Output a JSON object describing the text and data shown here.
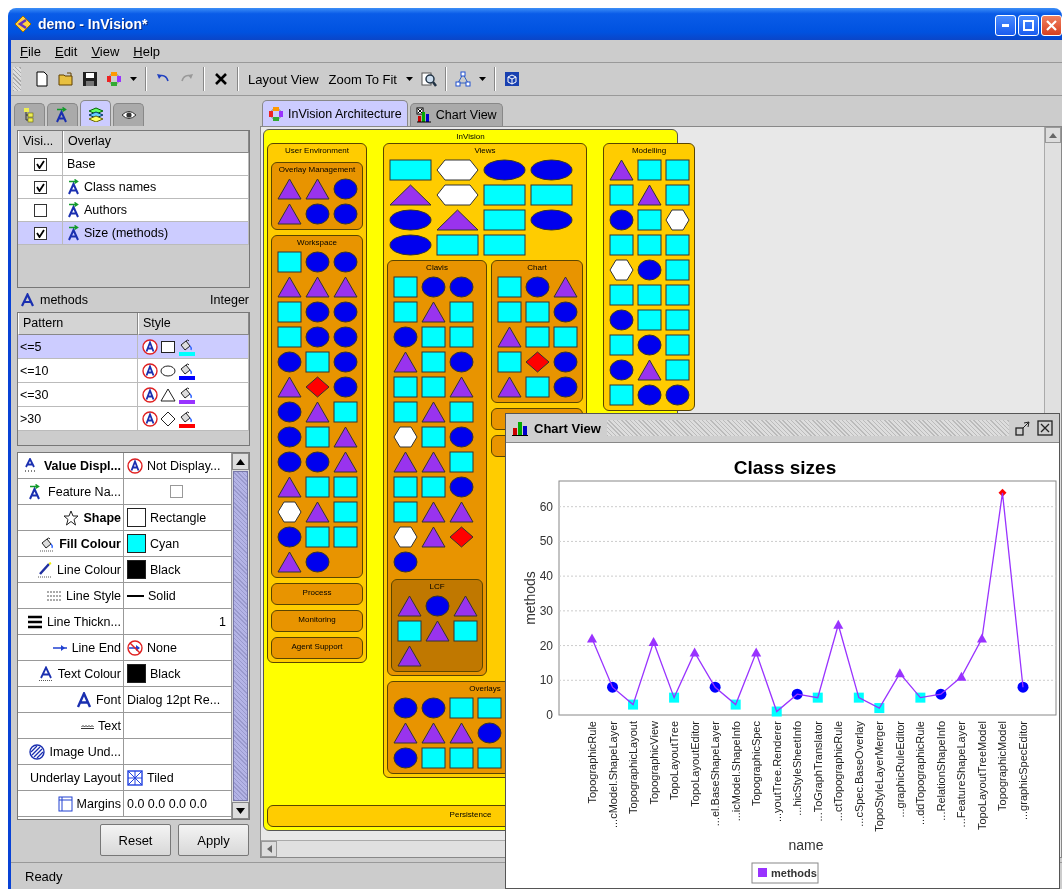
{
  "window": {
    "title": "demo - InVision*"
  },
  "menu": [
    "File",
    "Edit",
    "View",
    "Help"
  ],
  "toolbar": {
    "undo": {
      "disabled": false
    },
    "redo": {
      "disabled": true
    },
    "text_buttons": [
      "Layout View",
      "Zoom To Fit"
    ]
  },
  "panel_tabs": [
    {
      "selected": false
    },
    {
      "selected": false
    },
    {
      "selected": true
    },
    {
      "selected": false
    }
  ],
  "overlays": {
    "columns": [
      "Visi...",
      "Overlay"
    ],
    "rows": [
      {
        "name": "Base",
        "kind": "base",
        "visible": true,
        "selected": false
      },
      {
        "name": "Class names",
        "kind": "feature",
        "visible": true,
        "selected": false
      },
      {
        "name": "Authors",
        "kind": "feature",
        "visible": false,
        "selected": false
      },
      {
        "name": "Size (methods)",
        "kind": "feature",
        "visible": true,
        "selected": true
      }
    ]
  },
  "attribute": {
    "name": "methods",
    "type": "Integer"
  },
  "rules": {
    "columns": [
      "Pattern",
      "Style"
    ],
    "rows": [
      {
        "pattern": "<=5",
        "kind": "rectangle",
        "color": "#00ffff",
        "selected": true
      },
      {
        "pattern": "<=10",
        "kind": "ellipse",
        "color": "#0000ff",
        "selected": false
      },
      {
        "pattern": "<=30",
        "kind": "triangle",
        "color": "#9933ff",
        "selected": false
      },
      {
        "pattern": ">30",
        "kind": "diamond",
        "color": "#ff0000",
        "selected": false
      }
    ]
  },
  "properties": [
    {
      "label": "Value Displ...",
      "bold": true,
      "kind": "text",
      "value": "Not Display..."
    },
    {
      "label": "Feature Na...",
      "bold": false,
      "kind": "checkbox",
      "checked": false
    },
    {
      "label": "Shape",
      "bold": true,
      "kind": "swatch",
      "color": "#ffffff",
      "value": "Rectangle"
    },
    {
      "label": "Fill Colour",
      "bold": true,
      "kind": "swatch",
      "color": "#00ffff",
      "value": "Cyan"
    },
    {
      "label": "Line Colour",
      "bold": false,
      "kind": "swatch",
      "color": "#000000",
      "value": "Black"
    },
    {
      "label": "Line Style",
      "bold": false,
      "kind": "line",
      "value": "Solid"
    },
    {
      "label": "Line Thickn...",
      "bold": false,
      "kind": "number",
      "value": "1"
    },
    {
      "label": "Line End",
      "bold": false,
      "kind": "text",
      "value": "None"
    },
    {
      "label": "Text Colour",
      "bold": false,
      "kind": "swatch",
      "color": "#000000",
      "value": "Black"
    },
    {
      "label": "Font",
      "bold": false,
      "kind": "text",
      "value": "Dialog 12pt Re..."
    },
    {
      "label": "Text",
      "bold": false,
      "kind": "empty"
    },
    {
      "label": "Image Und...",
      "bold": false,
      "kind": "empty"
    },
    {
      "label": "Underlay Layout",
      "bold": false,
      "kind": "text",
      "value": "Tiled"
    },
    {
      "label": "Margins",
      "bold": false,
      "kind": "text",
      "value": "0.0 0.0 0.0 0.0"
    }
  ],
  "buttons": [
    "Reset",
    "Apply"
  ],
  "status": "Ready",
  "doc_tabs": [
    {
      "label": "InVision Architecture",
      "selected": true
    },
    {
      "label": "Chart View",
      "selected": false
    }
  ],
  "diagram": {
    "label": "InVision",
    "lanes": [
      [
        {
          "label": "User Environment",
          "groups": [
            {
              "label": "Overlay Management",
              "rows": [
                [
                  {
                    "kind": "triangle"
                  },
                  {
                    "kind": "triangle"
                  },
                  {
                    "kind": "circle"
                  }
                ],
                [
                  {
                    "kind": "triangle"
                  },
                  {
                    "kind": "circle"
                  },
                  {
                    "kind": "circle"
                  }
                ]
              ]
            },
            {
              "label": "Workspace",
              "rows": [
                [
                  {
                    "kind": "square"
                  },
                  {
                    "kind": "circle"
                  },
                  {
                    "kind": "circle"
                  }
                ],
                [
                  {
                    "kind": "triangle"
                  },
                  {
                    "kind": "triangle"
                  },
                  {
                    "kind": "triangle"
                  }
                ],
                [
                  {
                    "kind": "square"
                  },
                  {
                    "kind": "circle"
                  },
                  {
                    "kind": "circle"
                  }
                ],
                [
                  {
                    "kind": "square"
                  },
                  {
                    "kind": "circle"
                  },
                  {
                    "kind": "circle"
                  }
                ],
                [
                  {
                    "kind": "circle"
                  },
                  {
                    "kind": "square"
                  },
                  {
                    "kind": "circle"
                  }
                ],
                [
                  {
                    "kind": "triangle"
                  },
                  {
                    "kind": "diamond"
                  },
                  {
                    "kind": "circle"
                  }
                ],
                [
                  {
                    "kind": "circle"
                  },
                  {
                    "kind": "triangle"
                  },
                  {
                    "kind": "square"
                  }
                ],
                [
                  {
                    "kind": "circle"
                  },
                  {
                    "kind": "square"
                  },
                  {
                    "kind": "triangle"
                  }
                ],
                [
                  {
                    "kind": "circle"
                  },
                  {
                    "kind": "circle"
                  },
                  {
                    "kind": "triangle"
                  }
                ],
                [
                  {
                    "kind": "triangle"
                  },
                  {
                    "kind": "square"
                  },
                  {
                    "kind": "square"
                  }
                ],
                [
                  {
                    "kind": "hexagon"
                  },
                  {
                    "kind": "triangle"
                  },
                  {
                    "kind": "square"
                  }
                ],
                [
                  {
                    "kind": "circle"
                  },
                  {
                    "kind": "square"
                  },
                  {
                    "kind": "square"
                  }
                ],
                [
                  {
                    "kind": "triangle"
                  },
                  {
                    "kind": "circle"
                  }
                ]
              ]
            },
            {
              "label": "Process"
            },
            {
              "label": "Monitoring"
            },
            {
              "label": "Agent Support"
            }
          ]
        }
      ],
      [
        {
          "label": "Views",
          "rows": [
            [
              {
                "kind": "wide-rect"
              },
              {
                "kind": "wide-hexagon"
              },
              {
                "kind": "ellipse"
              },
              {
                "kind": "ellipse"
              }
            ],
            [
              {
                "kind": "wide-triangle"
              },
              {
                "kind": "wide-hexagon"
              },
              {
                "kind": "wide-rect"
              },
              {
                "kind": "wide-rect"
              }
            ],
            [
              {
                "kind": "ellipse"
              },
              {
                "kind": "wide-triangle"
              },
              {
                "kind": "wide-rect"
              },
              {
                "kind": "ellipse"
              }
            ],
            [
              {
                "kind": "ellipse"
              },
              {
                "kind": "wide-rect"
              },
              {
                "kind": "wide-rect"
              }
            ]
          ],
          "lanes": [
            [
              {
                "label": "Clavis",
                "rows": [
                  [
                    {
                      "kind": "square"
                    },
                    {
                      "kind": "circle"
                    },
                    {
                      "kind": "circle"
                    }
                  ],
                  [
                    {
                      "kind": "square"
                    },
                    {
                      "kind": "triangle"
                    },
                    {
                      "kind": "square"
                    }
                  ],
                  [
                    {
                      "kind": "circle"
                    },
                    {
                      "kind": "square"
                    },
                    {
                      "kind": "square"
                    }
                  ],
                  [
                    {
                      "kind": "triangle"
                    },
                    {
                      "kind": "square"
                    },
                    {
                      "kind": "circle"
                    }
                  ],
                  [
                    {
                      "kind": "square"
                    },
                    {
                      "kind": "square"
                    },
                    {
                      "kind": "triangle"
                    }
                  ],
                  [
                    {
                      "kind": "square"
                    },
                    {
                      "kind": "triangle"
                    },
                    {
                      "kind": "square"
                    }
                  ],
                  [
                    {
                      "kind": "hexagon"
                    },
                    {
                      "kind": "square"
                    },
                    {
                      "kind": "circle"
                    }
                  ],
                  [
                    {
                      "kind": "triangle"
                    },
                    {
                      "kind": "triangle"
                    },
                    {
                      "kind": "square"
                    }
                  ],
                  [
                    {
                      "kind": "square"
                    },
                    {
                      "kind": "square"
                    },
                    {
                      "kind": "circle"
                    }
                  ],
                  [
                    {
                      "kind": "square"
                    },
                    {
                      "kind": "triangle"
                    },
                    {
                      "kind": "triangle"
                    }
                  ],
                  [
                    {
                      "kind": "hexagon"
                    },
                    {
                      "kind": "triangle"
                    },
                    {
                      "kind": "diamond"
                    }
                  ],
                  [
                    {
                      "kind": "circle"
                    }
                  ]
                ],
                "groups": [
                  {
                    "label": "LCF",
                    "rows": [
                      [
                        {
                          "kind": "triangle"
                        },
                        {
                          "kind": "circle"
                        },
                        {
                          "kind": "triangle"
                        }
                      ],
                      [
                        {
                          "kind": "square"
                        },
                        {
                          "kind": "triangle"
                        },
                        {
                          "kind": "square"
                        }
                      ],
                      [
                        {
                          "kind": "triangle"
                        }
                      ]
                    ]
                  }
                ]
              }
            ],
            [
              {
                "label": "Chart",
                "rows": [
                  [
                    {
                      "kind": "square"
                    },
                    {
                      "kind": "circle"
                    },
                    {
                      "kind": "triangle"
                    }
                  ],
                  [
                    {
                      "kind": "square"
                    },
                    {
                      "kind": "square"
                    },
                    {
                      "kind": "circle"
                    }
                  ],
                  [
                    {
                      "kind": "triangle"
                    },
                    {
                      "kind": "square"
                    },
                    {
                      "kind": "square"
                    }
                  ],
                  [
                    {
                      "kind": "square"
                    },
                    {
                      "kind": "diamond"
                    },
                    {
                      "kind": "circle"
                    }
                  ],
                  [
                    {
                      "kind": "triangle"
                    },
                    {
                      "kind": "square"
                    },
                    {
                      "kind": "circle"
                    }
                  ]
                ]
              },
              {
                "kind": "package"
              },
              {
                "kind": "package"
              }
            ]
          ],
          "groups": [
            {
              "label": "Overlays",
              "rows": [
                [
                  {
                    "kind": "circle"
                  },
                  {
                    "kind": "circle"
                  },
                  {
                    "kind": "square"
                  },
                  {
                    "kind": "square"
                  }
                ],
                [
                  {
                    "kind": "triangle"
                  },
                  {
                    "kind": "triangle"
                  },
                  {
                    "kind": "triangle"
                  },
                  {
                    "kind": "circle"
                  }
                ],
                [
                  {
                    "kind": "circle"
                  },
                  {
                    "kind": "square"
                  },
                  {
                    "kind": "square"
                  },
                  {
                    "kind": "square"
                  }
                ]
              ]
            }
          ]
        }
      ],
      [
        {
          "label": "Modelling",
          "rows": [
            [
              {
                "kind": "triangle"
              },
              {
                "kind": "square"
              },
              {
                "kind": "square"
              }
            ],
            [
              {
                "kind": "square"
              },
              {
                "kind": "triangle"
              },
              {
                "kind": "square"
              }
            ],
            [
              {
                "kind": "circle"
              },
              {
                "kind": "square"
              },
              {
                "kind": "hexagon"
              }
            ],
            [
              {
                "kind": "square"
              },
              {
                "kind": "square"
              },
              {
                "kind": "square"
              }
            ],
            [
              {
                "kind": "hexagon"
              },
              {
                "kind": "circle"
              },
              {
                "kind": "square"
              }
            ],
            [
              {
                "kind": "square"
              },
              {
                "kind": "square"
              },
              {
                "kind": "square"
              }
            ],
            [
              {
                "kind": "circle"
              },
              {
                "kind": "square"
              },
              {
                "kind": "square"
              }
            ],
            [
              {
                "kind": "square"
              },
              {
                "kind": "circle"
              },
              {
                "kind": "square"
              }
            ],
            [
              {
                "kind": "circle"
              },
              {
                "kind": "triangle"
              },
              {
                "kind": "square"
              }
            ],
            [
              {
                "kind": "square"
              },
              {
                "kind": "circle"
              },
              {
                "kind": "circle"
              }
            ]
          ]
        }
      ]
    ],
    "groups": [
      {
        "label": "Persistence"
      }
    ]
  },
  "chart_view": {
    "title": "Chart View",
    "chart_data": {
      "type": "line",
      "title": "Class sizes",
      "xlabel": "name",
      "ylabel": "methods",
      "categories": [
        "TopographicRule",
        "...cModel.ShapeLayer",
        "TopographicLayout",
        "TopographicView",
        "TopoLayoutTree",
        "TopoLayoutEditor",
        "...el.BaseShapeLayer",
        "...icModel.ShapeInfo",
        "TopographicSpec",
        "...youtTree.Renderer",
        "...hicStyleSheetInfo",
        "...ToGraphTranslator",
        "...ctTopographicRule",
        "...cSpec.BaseOverlay",
        "TopoStyleLayerMerger",
        "...graphicRuleEditor",
        "...ddTopographicRule",
        "...RelationShapeInfo",
        "...FeatureShapeLayer",
        "TopoLayoutTreeModel",
        "TopographicModel",
        "...graphicSpecEditor"
      ],
      "series": [
        {
          "name": "methods",
          "color": "#9933ff",
          "marker": "triangle",
          "values": [
            22,
            8,
            3,
            21,
            5,
            18,
            8,
            3,
            18,
            1,
            6,
            5,
            26,
            5,
            2,
            12,
            5,
            6,
            11,
            22,
            64,
            8
          ]
        }
      ],
      "ylim": [
        0,
        67.4
      ],
      "yticks": [
        0,
        10,
        20,
        30,
        40,
        50,
        60
      ],
      "grid": true
    }
  }
}
